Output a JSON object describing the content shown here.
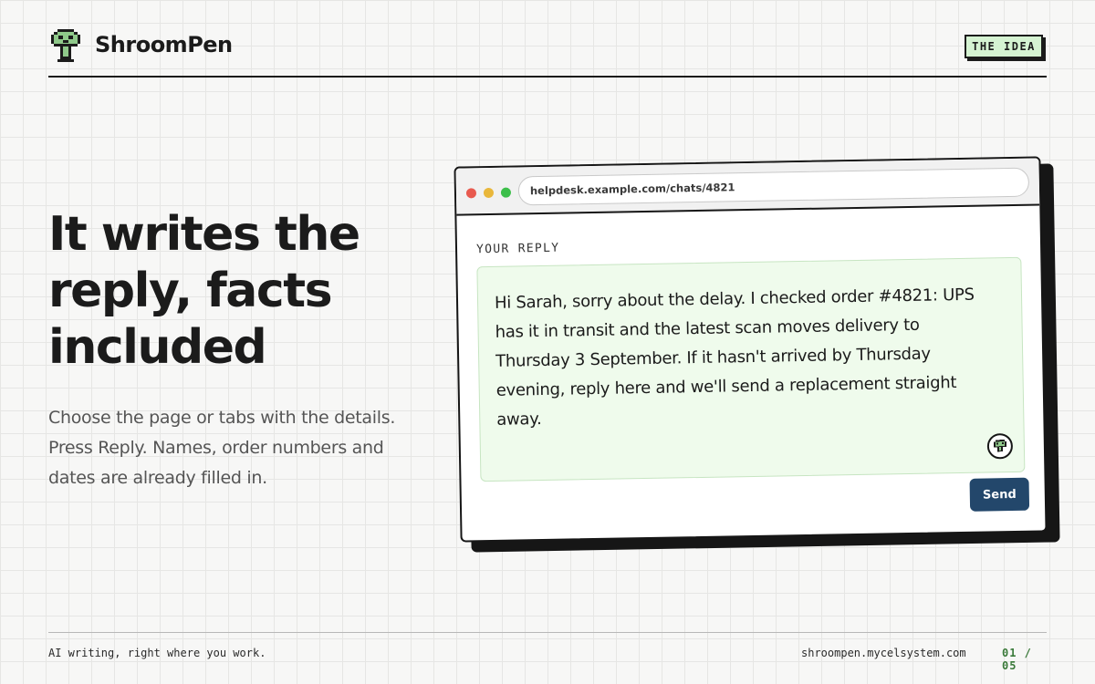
{
  "header": {
    "brand": "ShroomPen",
    "tag": "THE IDEA"
  },
  "hero": {
    "headline": "It writes the reply, facts included",
    "subtext": "Choose the page or tabs with the details. Press Reply. Names, order numbers and dates are already filled in."
  },
  "browser": {
    "url": "helpdesk.example.com/chats/4821",
    "reply_label": "YOUR REPLY",
    "reply_text": "Hi Sarah, sorry about the delay. I checked order #4821: UPS has it in transit and the latest scan moves delivery to Thursday 3 September. If it hasn't arrived by Thursday evening, reply here and we'll send a replacement straight away.",
    "send_label": "Send"
  },
  "footer": {
    "tagline": "AI writing, right where you work.",
    "url": "shroompen.mycelsystem.com",
    "page": "01 / 05"
  },
  "colors": {
    "accent_green": "#d5f3d2",
    "send_button": "#23476b",
    "reply_bg": "#effbec"
  },
  "icons": {
    "logo": "mushroom-icon",
    "assistant": "mushroom-icon"
  }
}
